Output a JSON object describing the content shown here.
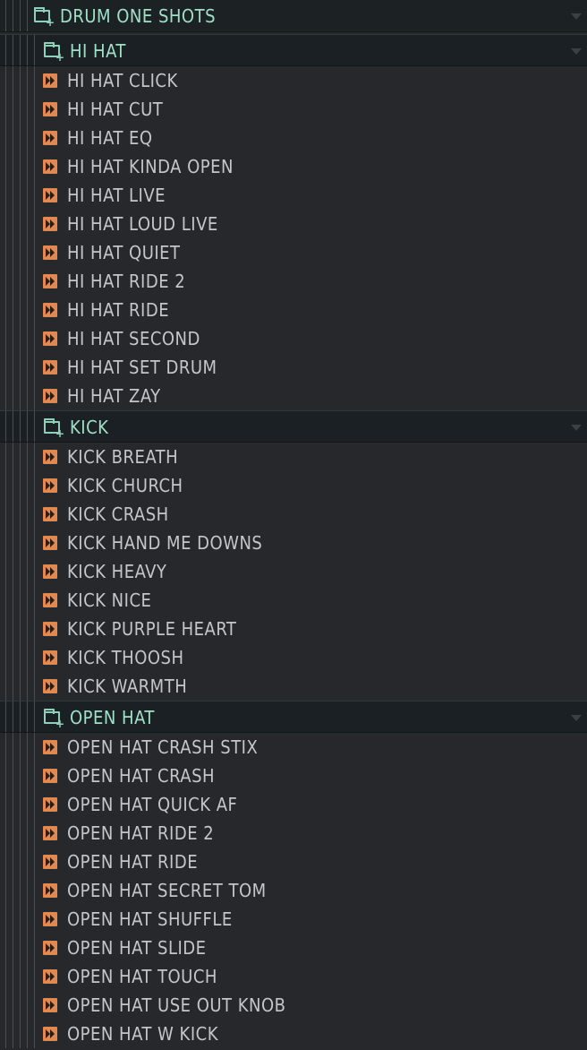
{
  "browser": {
    "root_folder": {
      "label": "DRUM ONE SHOTS"
    },
    "folders": [
      {
        "label": "HI HAT",
        "items": [
          "HI HAT CLICK",
          "HI HAT CUT",
          "HI HAT EQ",
          "HI HAT KINDA OPEN",
          "HI HAT LIVE",
          "HI HAT LOUD LIVE",
          "HI HAT QUIET",
          "HI HAT RIDE 2",
          "HI HAT RIDE",
          "HI HAT SECOND",
          "HI HAT SET DRUM",
          "HI HAT ZAY"
        ]
      },
      {
        "label": "KICK",
        "items": [
          "KICK BREATH",
          "KICK CHURCH",
          "KICK CRASH",
          "KICK HAND ME DOWNS",
          "KICK HEAVY",
          "KICK NICE",
          "KICK PURPLE HEART",
          "KICK THOOSH",
          "KICK WARMTH"
        ]
      },
      {
        "label": "OPEN HAT",
        "items": [
          "OPEN HAT CRASH STIX",
          "OPEN HAT CRASH",
          "OPEN HAT QUICK AF",
          "OPEN HAT RIDE 2",
          "OPEN HAT RIDE",
          "OPEN HAT SECRET TOM",
          "OPEN HAT SHUFFLE",
          "OPEN HAT SLIDE",
          "OPEN HAT TOUCH",
          "OPEN HAT USE OUT KNOB",
          "OPEN HAT W KICK"
        ]
      }
    ],
    "colors": {
      "background": "#27282c",
      "folder_text": "#9fe0c7",
      "item_text": "#c3c6cb",
      "sample_icon": "#e3884f"
    },
    "icons": {
      "folder": "folder-plus-icon",
      "sample": "audio-sample-icon",
      "expand": "chevron-down-icon"
    }
  }
}
